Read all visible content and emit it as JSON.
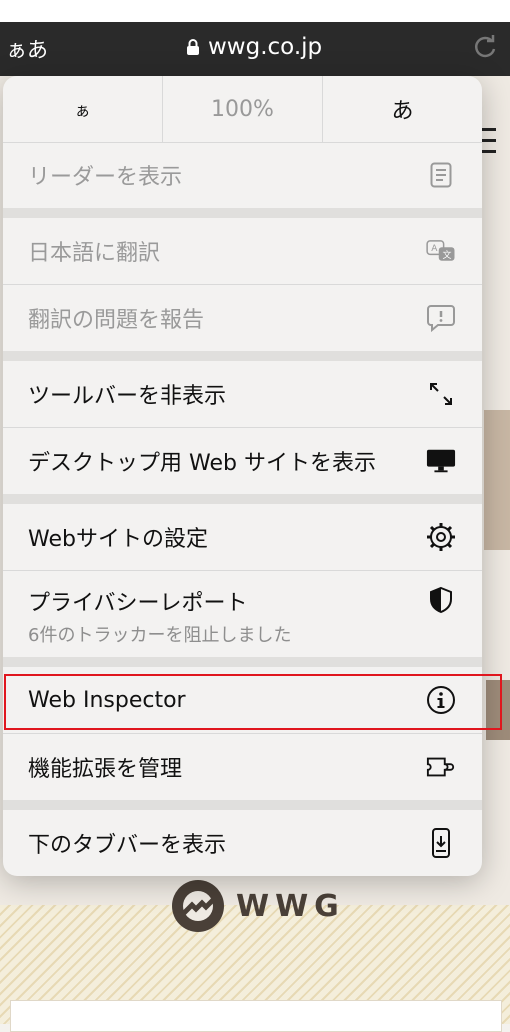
{
  "topbar": {
    "text_size": "ぁあ",
    "url": "wwg.co.jp"
  },
  "zoom": {
    "decrease": "ぁ",
    "level": "100%",
    "increase": "あ"
  },
  "menu": {
    "reader": "リーダーを表示",
    "translate": "日本語に翻訳",
    "report_translation": "翻訳の問題を報告",
    "hide_toolbar": "ツールバーを非表示",
    "desktop_site": "デスクトップ用 Web サイトを表示",
    "website_settings": "Webサイトの設定",
    "privacy_report": "プライバシーレポート",
    "privacy_sub": "6件のトラッカーを阻止しました",
    "web_inspector": "Web Inspector",
    "manage_extensions": "機能拡張を管理",
    "bottom_tab_bar": "下のタブバーを表示"
  },
  "background": {
    "logo_text": "WWG"
  },
  "colors": {
    "highlight": "#e0161e",
    "menu_bg": "#f3f2f1",
    "topbar_bg": "#2a2a2a"
  },
  "icons": {
    "reader": "reader-doc-icon",
    "translate": "translate-icon",
    "report": "report-bubble-icon",
    "hide_toolbar": "expand-arrows-icon",
    "desktop": "monitor-icon",
    "settings": "gear-icon",
    "privacy": "shield-icon",
    "inspector": "info-circle-icon",
    "extensions": "puzzle-icon",
    "tab_bar": "phone-down-icon"
  }
}
